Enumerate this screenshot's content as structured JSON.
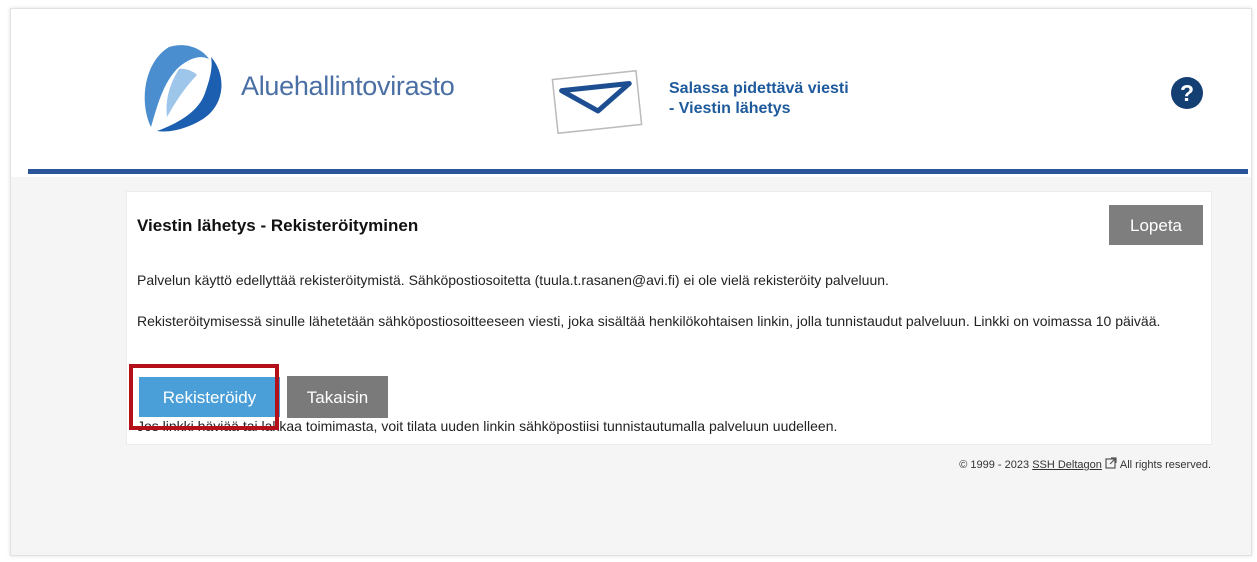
{
  "brand": {
    "name": "Aluehallintovirasto",
    "logo_icon": "avi-logo-icon",
    "accent_color": "#2a5599"
  },
  "service": {
    "icon": "envelope-icon",
    "title_line1": "Salassa pidettävä viesti",
    "title_line2": "- Viestin lähetys"
  },
  "help": {
    "icon": "help-icon",
    "label": "?"
  },
  "card": {
    "title": "Viestin lähetys - Rekisteröityminen",
    "exit_button": "Lopeta",
    "paragraph1": "Palvelun käyttö edellyttää rekisteröitymistä. Sähköpostiosoitetta (tuula.t.rasanen@avi.fi) ei ole vielä rekisteröity palveluun.",
    "paragraph2": "Rekisteröitymisessä sinulle lähetetään sähköpostiosoitteeseen viesti, joka sisältää henkilökohtaisen linkin, jolla tunnistaudut palveluun. Linkki on voimassa 10 päivää.",
    "paragraph3": "Jos linkki häviää tai lakkaa toimimasta, voit tilata uuden linkin sähköpostiisi tunnistautumalla palveluun uudelleen.",
    "register_button": "Rekisteröidy",
    "back_button": "Takaisin",
    "register_button_color": "#4a9fd8",
    "highlight_color": "#b3101a"
  },
  "footer": {
    "copyright": "© 1999 - 2023",
    "link": "SSH Deltagon",
    "link_icon": "external-link-icon",
    "rights": "All rights reserved."
  }
}
